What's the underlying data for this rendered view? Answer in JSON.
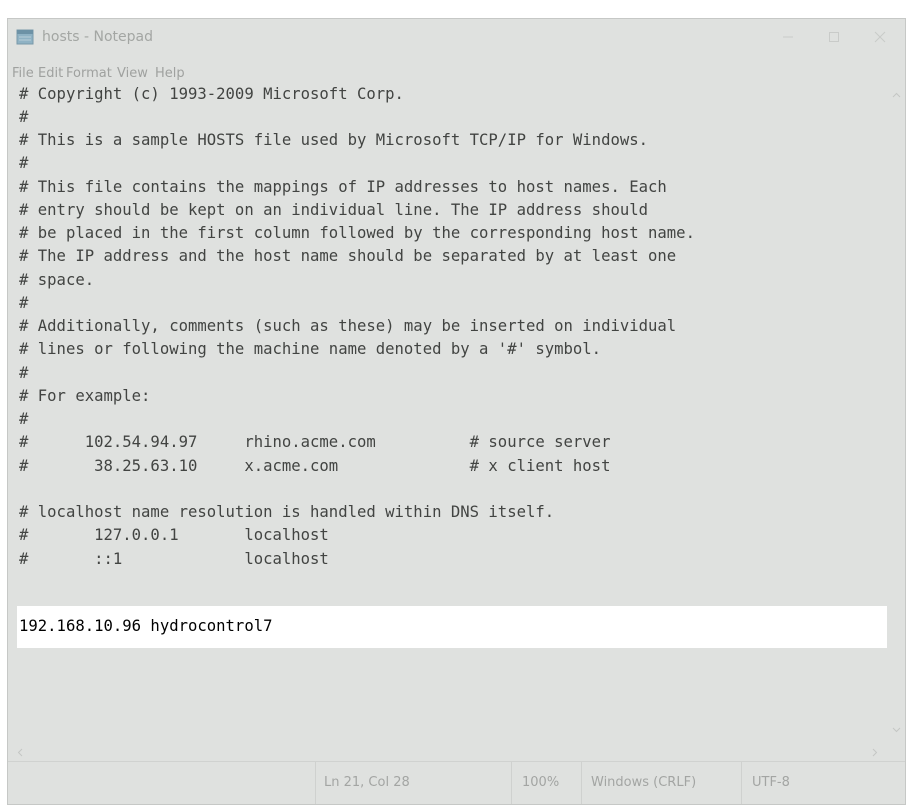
{
  "window": {
    "title": "hosts - Notepad",
    "icon": "notepad-icon"
  },
  "titlebar_buttons": {
    "minimize_icon": "minimize-icon",
    "maximize_icon": "maximize-icon",
    "close_icon": "close-icon"
  },
  "menu": {
    "items": [
      {
        "label": "File"
      },
      {
        "label": "Edit"
      },
      {
        "label": "Format"
      },
      {
        "label": "View"
      },
      {
        "label": "Help"
      }
    ]
  },
  "editor": {
    "lines": [
      "# Copyright (c) 1993-2009 Microsoft Corp.",
      "#",
      "# This is a sample HOSTS file used by Microsoft TCP/IP for Windows.",
      "#",
      "# This file contains the mappings of IP addresses to host names. Each",
      "# entry should be kept on an individual line. The IP address should",
      "# be placed in the first column followed by the corresponding host name.",
      "# The IP address and the host name should be separated by at least one",
      "# space.",
      "#",
      "# Additionally, comments (such as these) may be inserted on individual",
      "# lines or following the machine name denoted by a '#' symbol.",
      "#",
      "# For example:",
      "#",
      "#      102.54.94.97     rhino.acme.com          # source server",
      "#       38.25.63.10     x.acme.com              # x client host",
      "",
      "# localhost name resolution is handled within DNS itself.",
      "#       127.0.0.1       localhost",
      "#       ::1             localhost"
    ],
    "highlighted_line": "192.168.10.96 hydrocontrol7"
  },
  "statusbar": {
    "position": "Ln 21, Col 28",
    "zoom": "100%",
    "line_ending": "Windows (CRLF)",
    "encoding": "UTF-8"
  },
  "colors": {
    "dim_overlay": "#dfe1df",
    "highlight": "#ffffff",
    "dim_text": "#424442"
  }
}
